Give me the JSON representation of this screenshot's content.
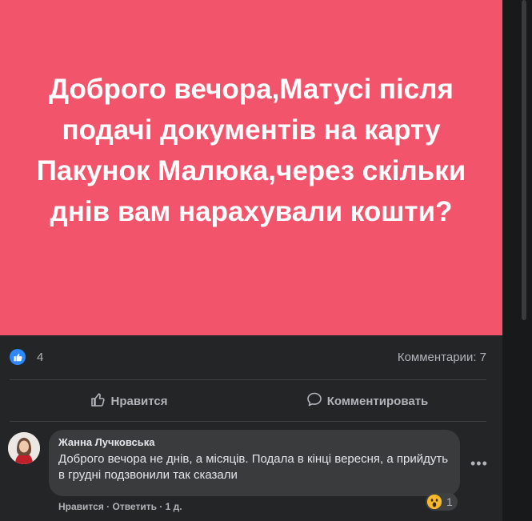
{
  "post": {
    "banner_text": "Доброго вечора,Матусі після подачі документів на карту Пакунок Малюка,через скільки днів вам нарахували кошти?",
    "banner_color": "#f2556b",
    "likes_count": "4",
    "comments_count_label": "Комментарии: 7"
  },
  "actions": {
    "like_label": "Нравится",
    "comment_label": "Комментировать"
  },
  "comment": {
    "author": "Жанна Лучковська",
    "text": "Доброго вечора не днів, а місяців. Подала в кінці вересня, а прийдуть в грудні подзвонили так сказали",
    "reaction_count": "1",
    "like_link": "Нравится",
    "separator": " · ",
    "reply_link": "Ответить",
    "time": "1 д."
  },
  "icons": {
    "like_badge": "thumbs-up-icon",
    "like_action": "thumbs-up-outline-icon",
    "comment_action": "speech-bubble-icon",
    "more": "more-options-icon",
    "reaction": "wow-emoji-icon"
  },
  "colors": {
    "accent": "#2d88ff",
    "surface": "#242526",
    "bubble": "#3a3b3c"
  }
}
